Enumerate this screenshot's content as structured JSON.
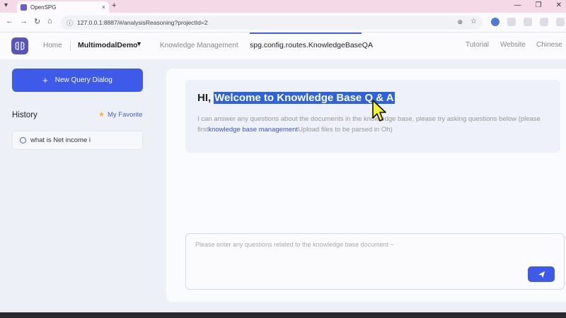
{
  "browser": {
    "tab_title": "OpenSPG",
    "tab_close": "×",
    "new_tab": "+",
    "url": "127.0.0.1:8887/#/analysisReasoning?projectId=2",
    "window_controls": [
      "—",
      "❐",
      "✕"
    ]
  },
  "header": {
    "home": "Home",
    "project": "MultimodalDemo",
    "knowledge_management": "Knowledge Management",
    "route": "spg.config.routes.KnowledgeBaseQA",
    "tutorial": "Tutorial",
    "website": "Website",
    "language": "Chinese"
  },
  "sidebar": {
    "new_query_label": "New Query Dialog",
    "history_title": "History",
    "favorite_label": "My Favorite",
    "history_items": [
      {
        "label": "what is Net income i"
      }
    ]
  },
  "main": {
    "greeting_prefix": "HI,",
    "greeting_highlight": "Welcome to Knowledge Base Q & A",
    "description_part1": "I can answer any questions about the documents in the knowledge base, please try asking questions below (please first",
    "description_link": "knowledge base management",
    "description_part2": "Upload files to be parsed in Oh)",
    "input_placeholder": "Please enter any questions related to the knowledge base document ~"
  },
  "icons": {
    "logo": "brain-icon",
    "send": "send-icon",
    "favorite": "star-icon",
    "history_item": "chat-icon"
  },
  "colors": {
    "accent": "#3d5ae8",
    "highlight": "#2e63d9",
    "tabbar": "#f6d9e6"
  }
}
